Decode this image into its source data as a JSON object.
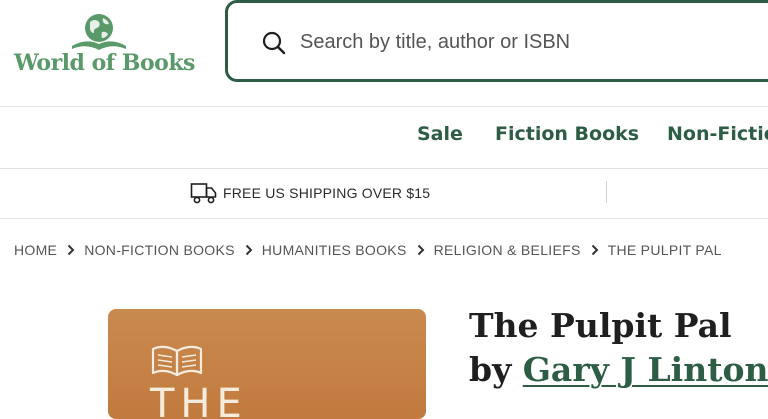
{
  "header": {
    "logo_text": "World of Books",
    "search": {
      "placeholder": "Search by title, author or ISBN",
      "value": ""
    }
  },
  "nav": {
    "items": [
      {
        "label": "Sale"
      },
      {
        "label": "Fiction Books"
      },
      {
        "label": "Non-Fictio"
      }
    ]
  },
  "shipping": {
    "text": "FREE US SHIPPING OVER $15"
  },
  "breadcrumb": {
    "items": [
      {
        "label": "HOME"
      },
      {
        "label": "NON-FICTION BOOKS"
      },
      {
        "label": "HUMANITIES BOOKS"
      },
      {
        "label": "RELIGION & BELIEFS"
      },
      {
        "label": "THE PULPIT PAL"
      }
    ]
  },
  "product": {
    "title": "The Pulpit Pal",
    "by": "by",
    "author": "Gary J Linton",
    "cover_text": "THE"
  },
  "colors": {
    "brand_green": "#2d5e45",
    "logo_green": "#5a9a6a",
    "cover": "#c27a3e"
  }
}
